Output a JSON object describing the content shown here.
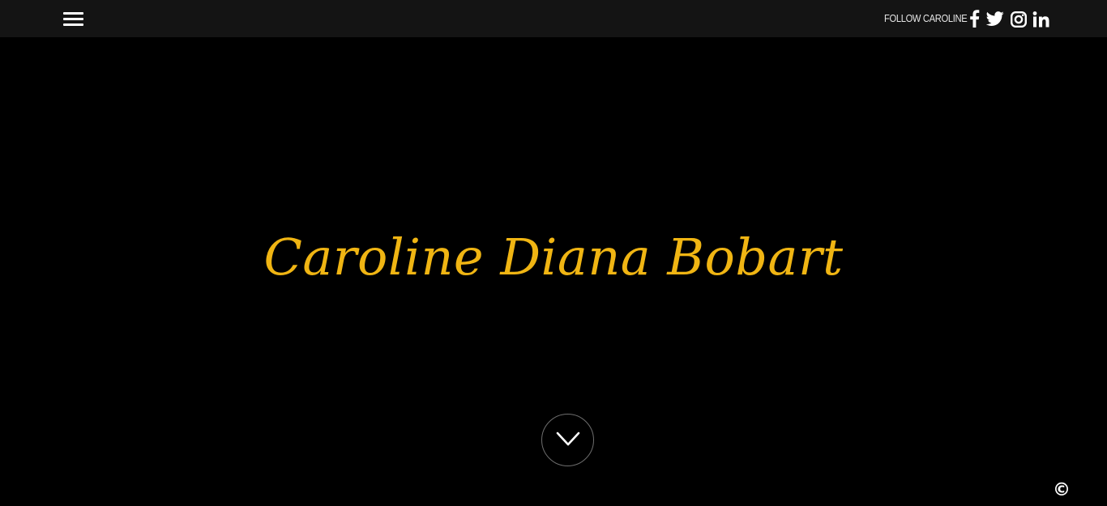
{
  "header": {
    "menu_icon": "hamburger-menu-icon",
    "follow_label": "FOLLOW CAROLINE",
    "social_links": [
      {
        "name": "facebook",
        "icon": "facebook-icon"
      },
      {
        "name": "twitter",
        "icon": "twitter-icon"
      },
      {
        "name": "instagram",
        "icon": "instagram-icon"
      },
      {
        "name": "linkedin",
        "icon": "linkedin-icon"
      }
    ]
  },
  "hero": {
    "title": "Caroline Diana Bobart",
    "scroll_icon": "chevron-down-icon"
  },
  "footer": {
    "copyright_symbol": "©"
  },
  "colors": {
    "background": "#000000",
    "topbar": "#141414",
    "accent": "#f0b513",
    "text": "#ffffff"
  }
}
